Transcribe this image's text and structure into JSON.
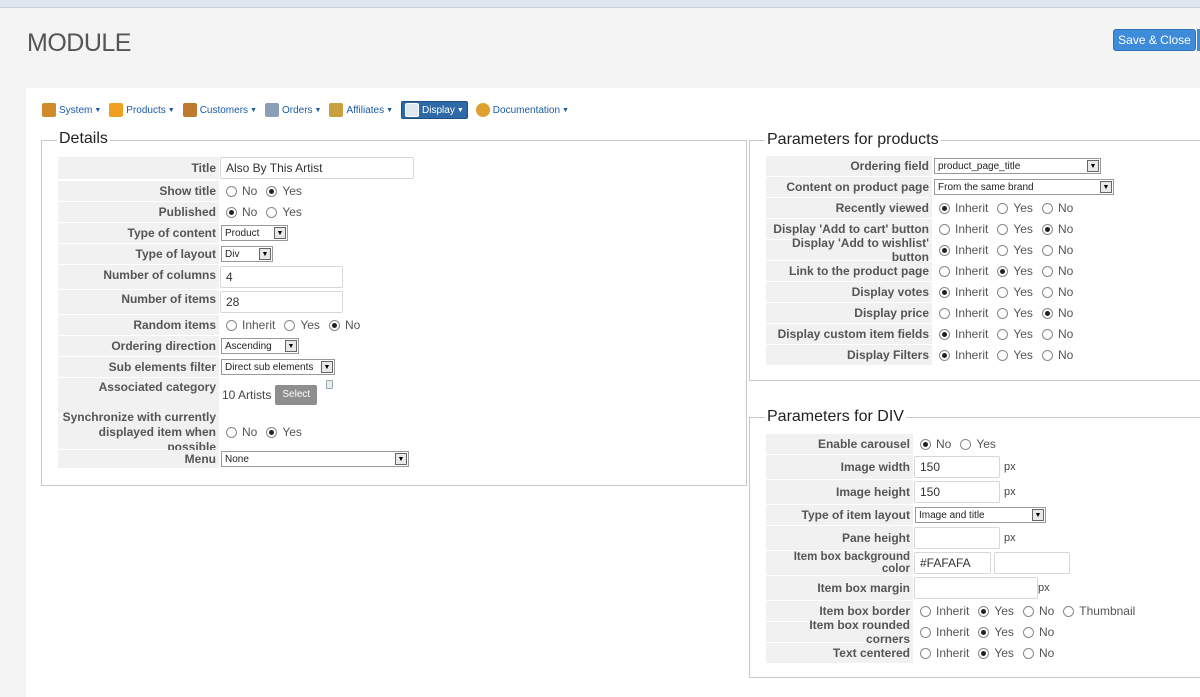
{
  "page": {
    "title": "MODULE"
  },
  "toolbar": {
    "save_close": "Save & Close"
  },
  "menu": [
    {
      "label": "System",
      "icon": "tools-icon",
      "color": "#d08a2a"
    },
    {
      "label": "Products",
      "icon": "products-icon",
      "color": "#f0a020"
    },
    {
      "label": "Customers",
      "icon": "customers-icon",
      "color": "#c07a30"
    },
    {
      "label": "Orders",
      "icon": "orders-icon",
      "color": "#8aa0b8"
    },
    {
      "label": "Affiliates",
      "icon": "affiliates-icon",
      "color": "#c8a040"
    },
    {
      "label": "Display",
      "icon": "display-icon",
      "color": "#dfe8f0"
    },
    {
      "label": "Documentation",
      "icon": "documentation-icon",
      "color": "#e0a030"
    }
  ],
  "details": {
    "legend": "Details",
    "title_label": "Title",
    "title_value": "Also By This Artist",
    "show_title_label": "Show title",
    "published_label": "Published",
    "type_content_label": "Type of content",
    "type_content_value": "Product",
    "type_layout_label": "Type of layout",
    "type_layout_value": "Div",
    "num_columns_label": "Number of columns",
    "num_columns_value": "4",
    "num_items_label": "Number of items",
    "num_items_value": "28",
    "random_label": "Random items",
    "ordering_dir_label": "Ordering direction",
    "ordering_dir_value": "Ascending",
    "sub_filter_label": "Sub elements filter",
    "sub_filter_value": "Direct sub elements",
    "assoc_cat_label": "Associated category",
    "assoc_cat_value": "10 Artists",
    "select_btn": "Select",
    "sync_label_1": "Synchronize with currently",
    "sync_label_2": "displayed item when possible",
    "menu_label": "Menu",
    "menu_value": "None"
  },
  "opts": {
    "no": "No",
    "yes": "Yes",
    "inherit": "Inherit",
    "thumbnail": "Thumbnail",
    "px": "px"
  },
  "products": {
    "legend": "Parameters for products",
    "ordering_field_label": "Ordering field",
    "ordering_field_value": "product_page_title",
    "content_label": "Content on product page",
    "content_value": "From the same brand",
    "recently_viewed_label": "Recently viewed",
    "add_cart_label": "Display 'Add to cart' button",
    "add_wishlist_label": "Display 'Add to wishlist' button",
    "link_label": "Link to the product page",
    "votes_label": "Display votes",
    "price_label": "Display price",
    "custom_fields_label": "Display custom item fields",
    "filters_label": "Display Filters"
  },
  "div": {
    "legend": "Parameters for DIV",
    "carousel_label": "Enable carousel",
    "img_width_label": "Image width",
    "img_width_value": "150",
    "img_height_label": "Image height",
    "img_height_value": "150",
    "item_layout_label": "Type of item layout",
    "item_layout_value": "Image and title",
    "pane_height_label": "Pane height",
    "bg_color_label": "Item box background color",
    "bg_color_value": "#FAFAFA",
    "margin_label": "Item box margin",
    "border_label": "Item box border",
    "rounded_label": "Item box rounded corners",
    "centered_label": "Text centered"
  }
}
